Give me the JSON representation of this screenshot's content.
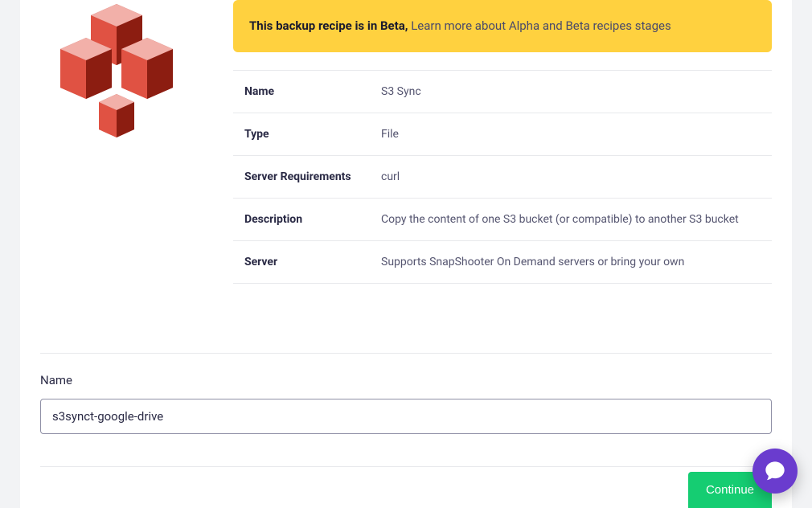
{
  "banner": {
    "strong": "This backup recipe is in Beta,",
    "link": "Learn more about Alpha and Beta recipes stages"
  },
  "info": {
    "rows": [
      {
        "label": "Name",
        "value": "S3 Sync"
      },
      {
        "label": "Type",
        "value": "File"
      },
      {
        "label": "Server Requirements",
        "value": "curl"
      },
      {
        "label": "Description",
        "value": "Copy the content of one S3 bucket (or compatible) to another S3 bucket"
      },
      {
        "label": "Server",
        "value": "Supports SnapShooter On Demand servers or bring your own"
      }
    ]
  },
  "nameSection": {
    "label": "Name",
    "value": "s3synct-google-drive"
  },
  "buttons": {
    "continue": "Continue"
  }
}
